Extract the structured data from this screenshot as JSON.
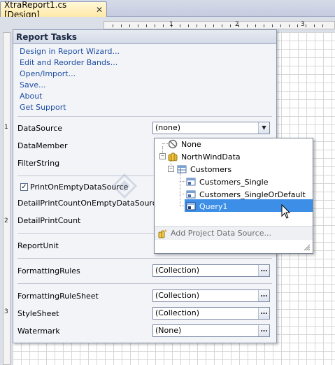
{
  "tab": {
    "title": "XtraReport1.cs [Design]",
    "close_glyph": "✕"
  },
  "ruler": {
    "numbers": [
      "1",
      "2",
      "3"
    ],
    "left_numbers": [
      "1",
      "2",
      "3"
    ]
  },
  "panel": {
    "title": "Report Tasks",
    "links": [
      "Design in Report Wizard...",
      "Edit and Reorder Bands...",
      "Open/Import...",
      "Save...",
      "About",
      "Get Support"
    ],
    "properties": {
      "datasource": {
        "label": "DataSource",
        "value": "(none)"
      },
      "datamember": {
        "label": "DataMember"
      },
      "filterstring": {
        "label": "FilterString"
      },
      "print_on_empty": {
        "label": "PrintOnEmptyDataSource",
        "checked": true
      },
      "detail_count_empty": {
        "label": "DetailPrintCountOnEmptyDataSource"
      },
      "detail_count": {
        "label": "DetailPrintCount"
      },
      "report_unit": {
        "label": "ReportUnit"
      },
      "formatting_rules": {
        "label": "FormattingRules",
        "value": "(Collection)"
      },
      "formatting_rule_sheet": {
        "label": "FormattingRuleSheet",
        "value": "(Collection)"
      },
      "style_sheet": {
        "label": "StyleSheet",
        "value": "(Collection)"
      },
      "watermark": {
        "label": "Watermark",
        "value": "(None)"
      }
    }
  },
  "dropdown": {
    "items": {
      "none": "None",
      "northwind": "NorthWindData",
      "customers": "Customers",
      "customers_single": "Customers_Single",
      "customers_single_or_default": "Customers_SingleOrDefault",
      "query1": "Query1"
    },
    "selected": "Query1",
    "add_source": "Add Project Data Source..."
  },
  "colors": {
    "link": "#1f4fa3",
    "selection": "#3d8ee6",
    "tab_active": "#ffe9a6"
  }
}
